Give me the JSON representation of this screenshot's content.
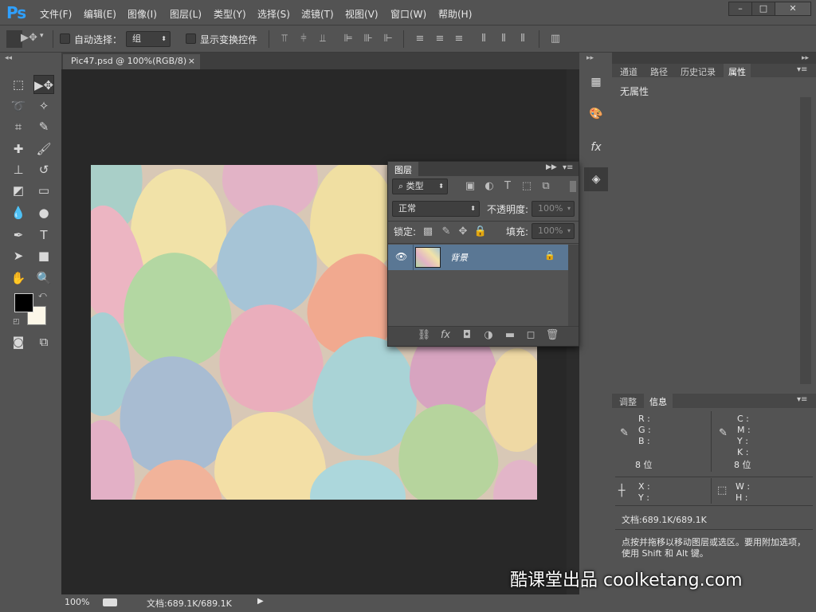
{
  "app": {
    "logo": "Ps"
  },
  "menu": [
    "文件(F)",
    "编辑(E)",
    "图像(I)",
    "图层(L)",
    "类型(Y)",
    "选择(S)",
    "滤镜(T)",
    "视图(V)",
    "窗口(W)",
    "帮助(H)"
  ],
  "window_controls": {
    "minimize": "–",
    "restore": "□",
    "close": "✕"
  },
  "options": {
    "auto_select_label": "自动选择：",
    "auto_select_value": "组",
    "show_transform_label": "显示变换控件"
  },
  "document": {
    "tab_title": "Pic47.psd @ 100%(RGB/8)",
    "tab_close": "×",
    "zoom": "100%",
    "doc_size": "文档:689.1K/689.1K"
  },
  "right_tabs": [
    "通道",
    "路径",
    "历史记录",
    "属性"
  ],
  "properties": {
    "no_props": "无属性"
  },
  "info": {
    "tabs": [
      "调整",
      "信息"
    ],
    "rgb": [
      "R :",
      "G :",
      "B :"
    ],
    "cmyk": [
      "C :",
      "M :",
      "Y :",
      "K :"
    ],
    "bits_left": "8 位",
    "bits_right": "8 位",
    "xy": [
      "X :",
      "Y :"
    ],
    "wh": [
      "W :",
      "H :"
    ],
    "doc_size": "文档:689.1K/689.1K",
    "hint": "点按并拖移以移动图层或选区。要用附加选项，使用 Shift 和 Alt 键。"
  },
  "layers": {
    "title": "图层",
    "filter_label": "类型",
    "blend_mode": "正常",
    "opacity_label": "不透明度:",
    "opacity_value": "100%",
    "lock_label": "锁定:",
    "fill_label": "填充:",
    "fill_value": "100%",
    "layer_name": "背景"
  },
  "watermark": "酷课堂出品 coolketang.com",
  "colors": {
    "accent_tab": "#2fa0ff",
    "selected_layer": "#5a7794",
    "canvas_bg": "#282828"
  }
}
